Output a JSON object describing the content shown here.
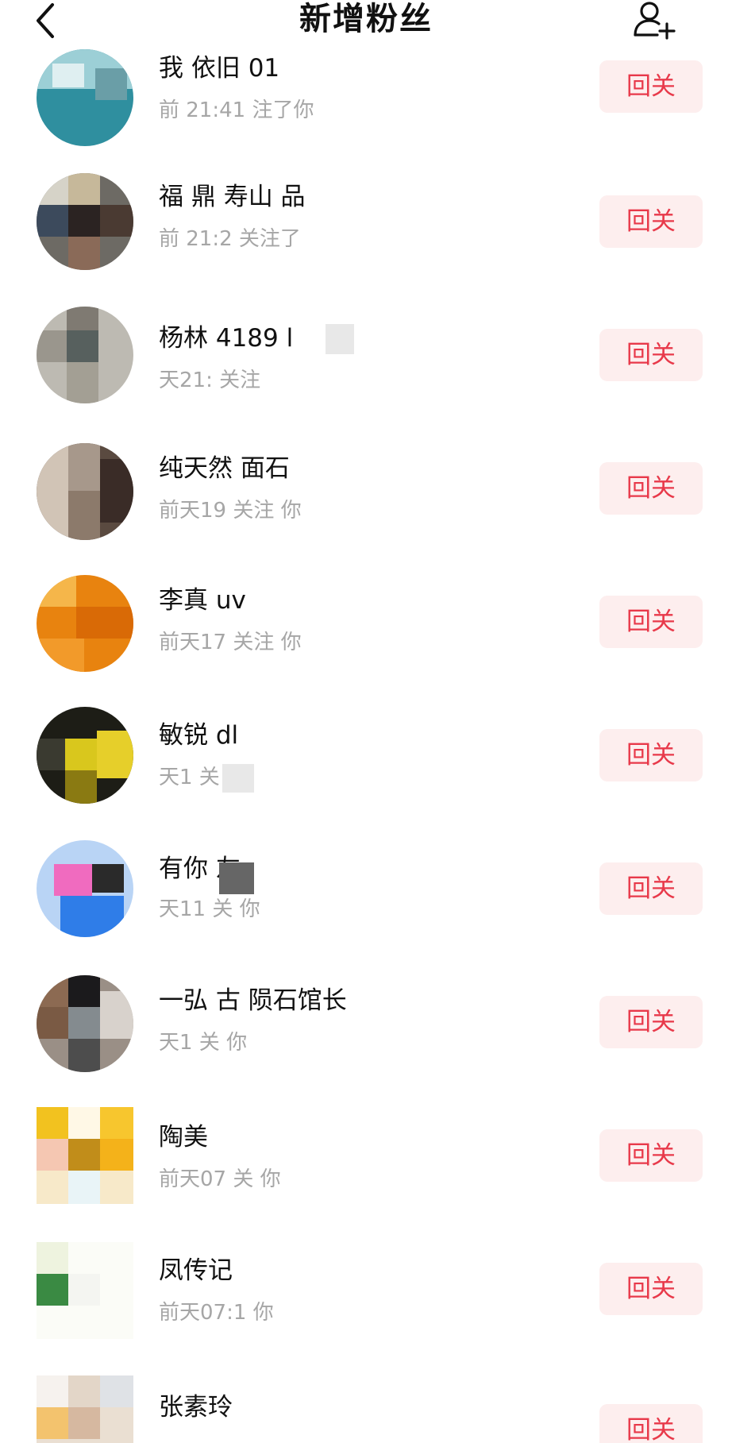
{
  "header": {
    "title": "新增粉丝",
    "back_icon": "chevron-left-icon",
    "add_icon": "add-user-icon"
  },
  "colors": {
    "accent": "#e8394a",
    "button_bg": "#fdeeee",
    "meta_text": "#a6a6a6"
  },
  "followers": [
    {
      "name": "我 依旧 01",
      "meta": "前 21:41 注了你",
      "button": "回关"
    },
    {
      "name": "福 鼎 寿山 品",
      "meta": "前 21:2 关注了",
      "button": "回关"
    },
    {
      "name": " 杨林 4189 l",
      "meta": "天21: 关注",
      "button": "回关"
    },
    {
      "name": "纯天然 面石",
      "meta": "前天19 关注 你",
      "button": "回关"
    },
    {
      "name": "李真 uv",
      "meta": "前天17 关注 你",
      "button": "回关"
    },
    {
      "name": "敏锐 dl",
      "meta": "天1 关 你",
      "button": "回关"
    },
    {
      "name": "有你 友",
      "meta": "天11 关 你",
      "button": "回关"
    },
    {
      "name": "一弘 古 陨石馆长",
      "meta": "天1 关 你",
      "button": "回关"
    },
    {
      "name": "陶美",
      "meta": "前天07 关 你",
      "button": "回关"
    },
    {
      "name": "凤传记",
      "meta": "前天07:1 你",
      "button": "回关"
    },
    {
      "name": "张素玲",
      "meta": "",
      "button": "回关"
    }
  ]
}
